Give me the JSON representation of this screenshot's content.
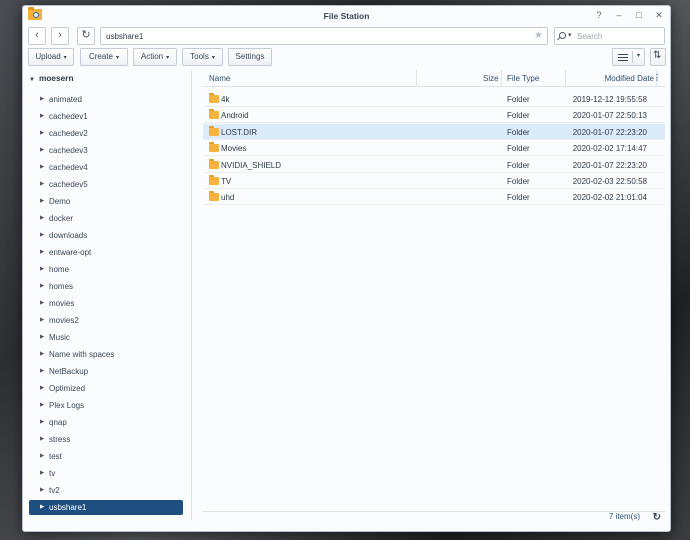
{
  "window": {
    "title": "File Station"
  },
  "titlebar": {
    "help": "?",
    "minimize": "–",
    "maximize": "□",
    "close": "✕"
  },
  "nav": {
    "back": "‹",
    "forward": "›",
    "refresh": "↻",
    "path": "usbshare1",
    "favorite": "★",
    "search_placeholder": "Search",
    "search_caret": "▾"
  },
  "toolbar": {
    "upload": "Upload",
    "create": "Create",
    "action": "Action",
    "tools": "Tools",
    "settings": "Settings",
    "caret": "▾",
    "view_caret": "▾",
    "sort": "⇅"
  },
  "tree": {
    "root": "moesern",
    "arrow_open": "▼",
    "arrow_closed": "▶",
    "items": [
      "animated",
      "cachedev1",
      "cachedev2",
      "cachedev3",
      "cachedev4",
      "cachedev5",
      "Demo",
      "docker",
      "downloads",
      "entware-opt",
      "home",
      "homes",
      "movies",
      "movies2",
      "Music",
      "Name with spaces",
      "NetBackup",
      "Optimized",
      "Plex Logs",
      "qnap",
      "stress",
      "test",
      "tv",
      "tv2",
      "usbshare1"
    ],
    "selected": "usbshare1"
  },
  "grid": {
    "columns": {
      "name": "Name",
      "size": "Size",
      "type": "File Type",
      "modified": "Modified Date",
      "menu": "⋮"
    },
    "rows": [
      {
        "name": "4k",
        "size": "",
        "type": "Folder",
        "modified": "2019-12-12 19:55:58"
      },
      {
        "name": "Android",
        "size": "",
        "type": "Folder",
        "modified": "2020-01-07 22:50:13"
      },
      {
        "name": "LOST.DIR",
        "size": "",
        "type": "Folder",
        "modified": "2020-01-07 22:23:20"
      },
      {
        "name": "Movies",
        "size": "",
        "type": "Folder",
        "modified": "2020-02-02 17:14:47"
      },
      {
        "name": "NVIDIA_SHIELD",
        "size": "",
        "type": "Folder",
        "modified": "2020-01-07 22:23:20"
      },
      {
        "name": "TV",
        "size": "",
        "type": "Folder",
        "modified": "2020-02-03 22:50:58"
      },
      {
        "name": "uhd",
        "size": "",
        "type": "Folder",
        "modified": "2020-02-02 21:01:04"
      }
    ],
    "highlighted_row": "LOST.DIR"
  },
  "footer": {
    "count": "7 item(s)",
    "refresh": "↻"
  },
  "colors": {
    "accent": "#1e4f80",
    "folder": "#f6b23e",
    "highlight": "#dcebf9"
  }
}
